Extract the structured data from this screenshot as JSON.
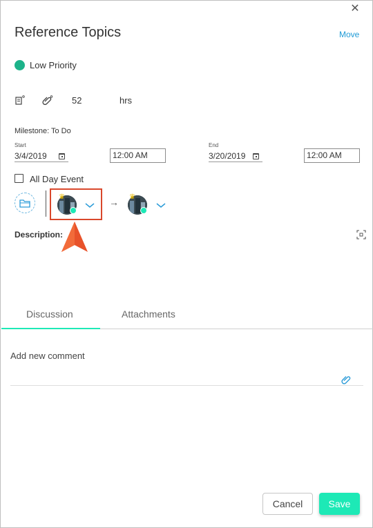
{
  "dialog": {
    "title": "Reference Topics",
    "move_label": "Move",
    "close_glyph": "✕"
  },
  "priority": {
    "label": "Low Priority",
    "color": "#1db38a"
  },
  "stats": {
    "hours_value": "52",
    "hours_unit": "hrs"
  },
  "milestone": {
    "label": "Milestone: To Do"
  },
  "dates": {
    "start_label": "Start",
    "start_date": "3/4/2019",
    "start_time": "12:00 AM",
    "end_label": "End",
    "end_date": "3/20/2019",
    "end_time": "12:00 AM"
  },
  "all_day": {
    "label": "All Day Event",
    "checked": false
  },
  "assignment": {
    "arrow_glyph": "→"
  },
  "description": {
    "label": "Description:"
  },
  "tabs": [
    {
      "label": "Discussion",
      "active": true
    },
    {
      "label": "Attachments",
      "active": false
    }
  ],
  "comment": {
    "placeholder": "Add new comment"
  },
  "actions": {
    "cancel_label": "Cancel",
    "save_label": "Save"
  },
  "colors": {
    "accent": "#1de9b6",
    "link": "#1e9ad6",
    "highlight": "#d9472b"
  }
}
